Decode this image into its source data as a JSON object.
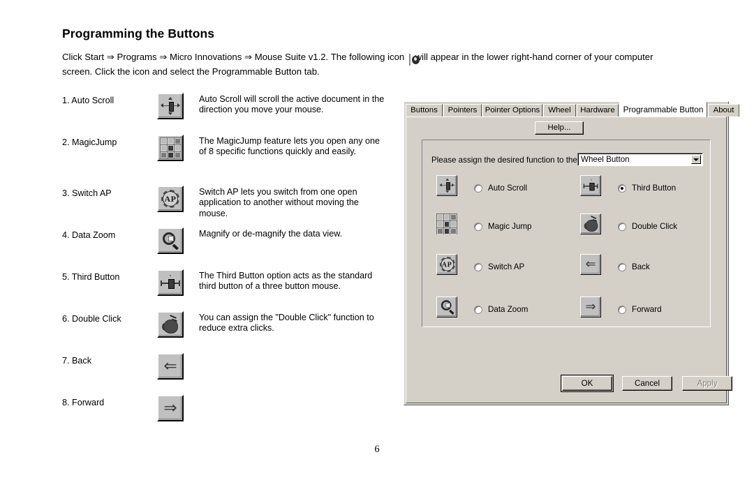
{
  "document": {
    "title": "Programming the Buttons",
    "intro_part1": "Click Start ⇒ Programs ⇒ Micro Innovations ⇒ Mouse Suite v1.2. The following icon",
    "intro_part2": "will appear in the lower right-hand corner of your computer screen. Click the icon and select the Programmable Button tab.",
    "tray_icon_name": "mouse-suite-tray-icon",
    "page_number": "6"
  },
  "features": [
    {
      "name": "1. Auto Scroll",
      "icon": "auto-scroll-icon",
      "description": "Auto Scroll will scroll the active document in the direction you move your mouse."
    },
    {
      "name": "2. MagicJump",
      "icon": "magic-jump-icon",
      "description": "The MagicJump feature lets you open any one of 8 specific functions quickly and easily."
    },
    {
      "name": "3. Switch AP",
      "icon": "switch-ap-icon",
      "description": "Switch AP lets you switch from one open application to another without moving the mouse."
    },
    {
      "name": "4. Data Zoom",
      "icon": "data-zoom-icon",
      "description": "Magnify or de-magnify the data view."
    },
    {
      "name": "5. Third Button",
      "icon": "third-button-icon",
      "description": "The Third Button option acts as the standard third button of a three button mouse."
    },
    {
      "name": "6. Double Click",
      "icon": "double-click-icon",
      "description": "You can assign the \"Double Click\" function to reduce extra clicks."
    },
    {
      "name": "7. Back",
      "icon": "back-arrow-icon",
      "description": ""
    },
    {
      "name": "8. Forward",
      "icon": "forward-arrow-icon",
      "description": ""
    }
  ],
  "dialog": {
    "tabs": [
      {
        "label": "Buttons",
        "active": false
      },
      {
        "label": "Pointers",
        "active": false
      },
      {
        "label": "Pointer Options",
        "active": false
      },
      {
        "label": "Wheel",
        "active": false
      },
      {
        "label": "Hardware",
        "active": false
      },
      {
        "label": "Programmable Button",
        "active": true
      },
      {
        "label": "About",
        "active": false
      }
    ],
    "help_label": "Help...",
    "assign_label": "Please assign the desired function to the",
    "combo": {
      "value": "Wheel Button",
      "options": [
        "Wheel Button"
      ]
    },
    "options": [
      {
        "label": "Auto Scroll",
        "icon": "auto-scroll-icon",
        "checked": false
      },
      {
        "label": "Third Button",
        "icon": "third-button-icon",
        "checked": true
      },
      {
        "label": "Magic Jump",
        "icon": "magic-jump-icon",
        "checked": false
      },
      {
        "label": "Double Click",
        "icon": "double-click-icon",
        "checked": false
      },
      {
        "label": "Switch AP",
        "icon": "switch-ap-icon",
        "checked": false
      },
      {
        "label": "Back",
        "icon": "back-arrow-icon",
        "checked": false
      },
      {
        "label": "Data Zoom",
        "icon": "data-zoom-icon",
        "checked": false
      },
      {
        "label": "Forward",
        "icon": "forward-arrow-icon",
        "checked": false
      }
    ],
    "buttons": [
      {
        "label": "OK",
        "state": "default"
      },
      {
        "label": "Cancel",
        "state": "normal"
      },
      {
        "label": "Apply",
        "state": "disabled"
      }
    ]
  },
  "colors": {
    "dialog_face": "#d4d0c8",
    "icon_face": "#c0c0c0",
    "active_tab": "#ffffff",
    "page_bg": "#ffffff"
  }
}
